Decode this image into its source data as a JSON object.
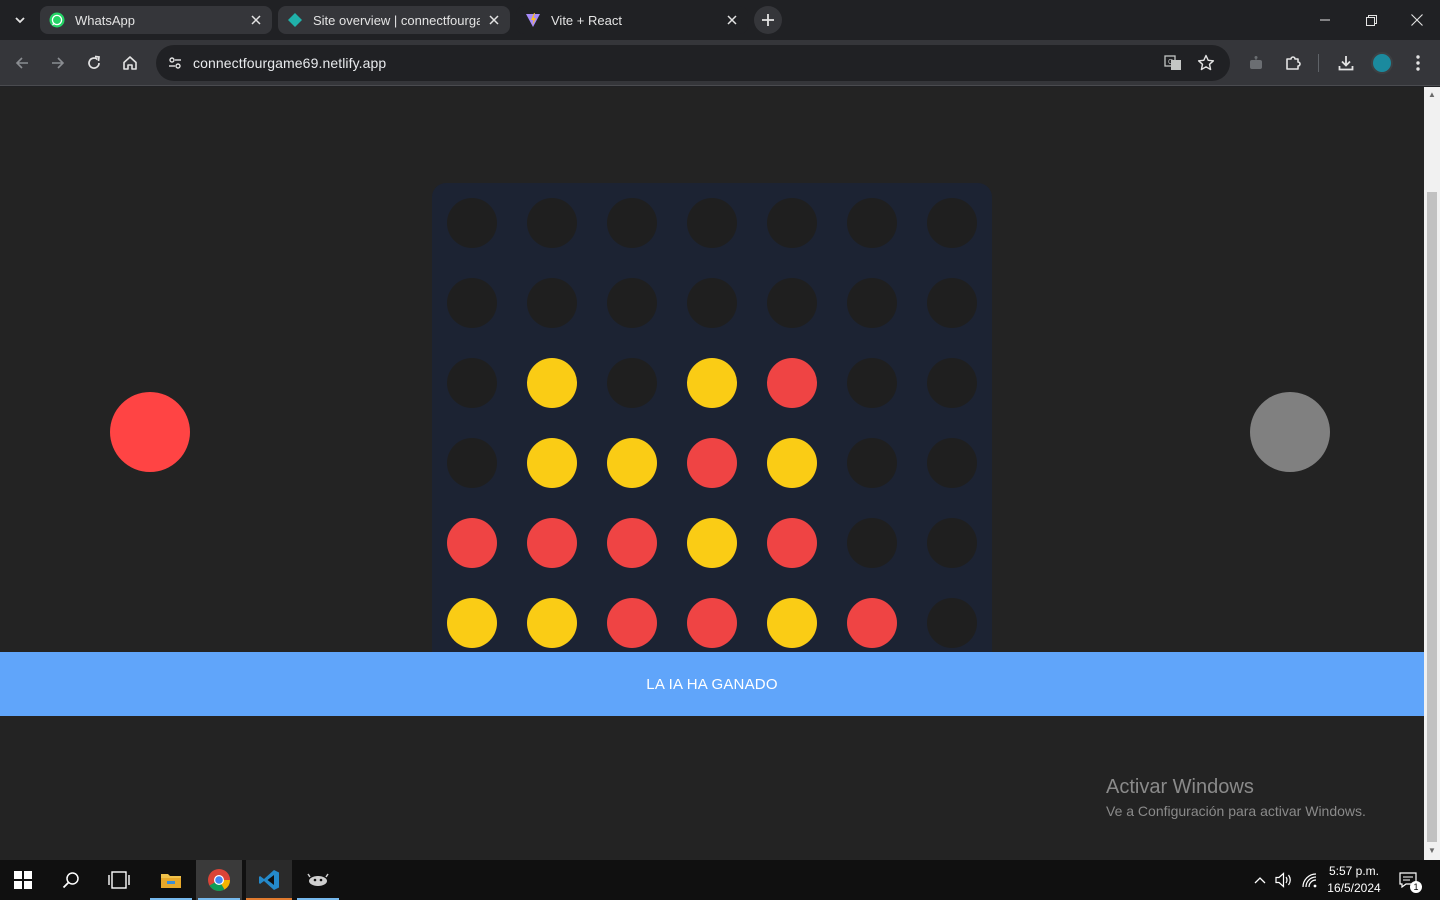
{
  "browser": {
    "tabs": [
      {
        "title": "WhatsApp",
        "icon": "whatsapp-icon",
        "state": "inactive"
      },
      {
        "title": "Site overview | connectfourgam",
        "icon": "netlify-icon",
        "state": "inactive"
      },
      {
        "title": "Vite + React",
        "icon": "vite-icon",
        "state": "active"
      }
    ],
    "url": "connectfourgame69.netlify.app"
  },
  "game": {
    "board": {
      "rows": [
        [
          "empty",
          "empty",
          "empty",
          "empty",
          "empty",
          "empty",
          "empty"
        ],
        [
          "empty",
          "empty",
          "empty",
          "empty",
          "empty",
          "empty",
          "empty"
        ],
        [
          "empty",
          "yellow",
          "empty",
          "yellow",
          "red",
          "empty",
          "empty"
        ],
        [
          "empty",
          "yellow",
          "yellow",
          "red",
          "yellow",
          "empty",
          "empty"
        ],
        [
          "red",
          "red",
          "red",
          "yellow",
          "red",
          "empty",
          "empty"
        ],
        [
          "yellow",
          "yellow",
          "red",
          "red",
          "yellow",
          "red",
          "empty"
        ]
      ]
    },
    "colors": {
      "red": "#ef4444",
      "yellow": "#facc15",
      "empty": "#1f1f1f",
      "board": "#1c2333",
      "banner": "#60a5fa",
      "player_red": "#ff4444",
      "player_grey": "#808080"
    },
    "result_text": "LA IA HA GANADO"
  },
  "watermark": {
    "title": "Activar Windows",
    "subtitle": "Ve a Configuración para activar Windows."
  },
  "taskbar": {
    "time": "5:57 p.m.",
    "date": "16/5/2024",
    "notification_count": "1",
    "apps": [
      "start-icon",
      "search-icon",
      "task-view-icon",
      "file-explorer-icon",
      "chrome-icon",
      "vscode-icon",
      "game-app-icon"
    ]
  }
}
